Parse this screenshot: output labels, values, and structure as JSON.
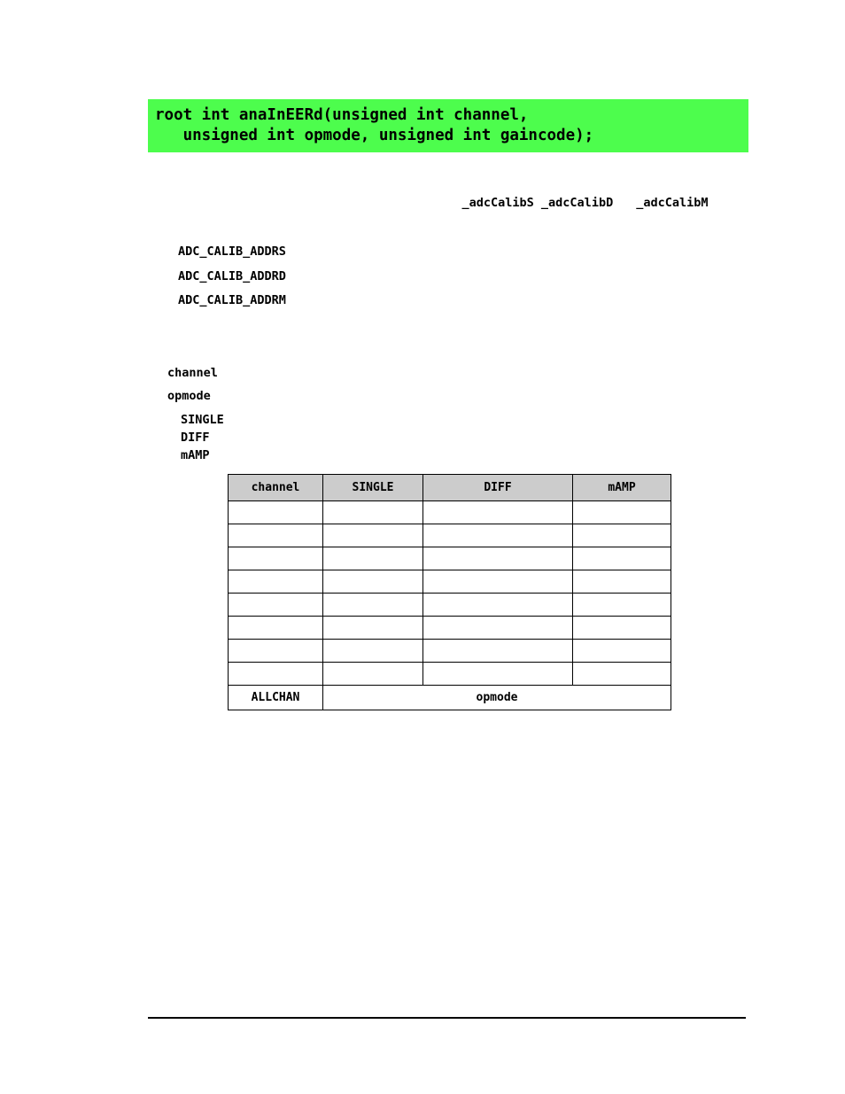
{
  "code_banner": {
    "background_color": "#4dfd4d",
    "lines": [
      "root int anaInEERd(unsigned int channel,",
      "   unsigned int opmode, unsigned int gaincode);"
    ]
  },
  "calib_constants": {
    "first": "_adcCalibS _adcCalibD",
    "second": "_adcCalibM"
  },
  "address_defines": [
    "ADC_CALIB_ADDRS",
    "ADC_CALIB_ADDRD",
    "ADC_CALIB_ADDRM"
  ],
  "parameters": {
    "channel_label": "channel",
    "opmode_label": "opmode",
    "opmode_options": [
      "SINGLE",
      "DIFF",
      "mAMP"
    ]
  },
  "channel_table": {
    "header_background": "#cccccc",
    "headers": [
      "channel",
      "SINGLE",
      "DIFF",
      "mAMP"
    ],
    "rows": [
      [
        "",
        "",
        "",
        ""
      ],
      [
        "",
        "",
        "",
        ""
      ],
      [
        "",
        "",
        "",
        ""
      ],
      [
        "",
        "",
        "",
        ""
      ],
      [
        "",
        "",
        "",
        ""
      ],
      [
        "",
        "",
        "",
        ""
      ],
      [
        "",
        "",
        "",
        ""
      ],
      [
        "",
        "",
        "",
        ""
      ]
    ],
    "footer_row": {
      "label": "ALLCHAN",
      "merged_value": "opmode",
      "merged_colspan": 3
    }
  }
}
